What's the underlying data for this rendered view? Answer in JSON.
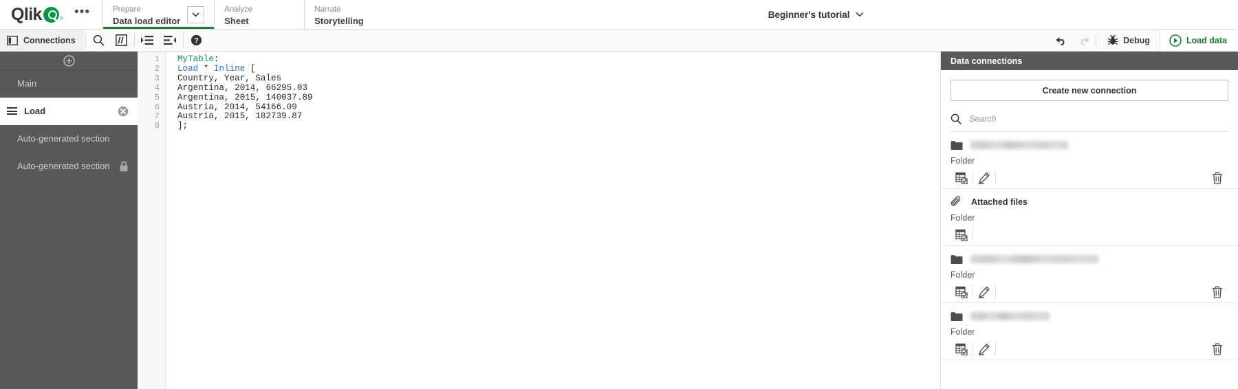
{
  "brand": {
    "name": "Qlik",
    "accent_green": "#009845",
    "active_tab_green": "#1a7d35",
    "sidebar_grey": "#595959"
  },
  "topbar": {
    "overflow_label": "•••",
    "tabs": [
      {
        "kicker": "Prepare",
        "title": "Data load editor",
        "active": true,
        "has_chevron": true
      },
      {
        "kicker": "Analyze",
        "title": "Sheet",
        "active": false,
        "has_chevron": false
      },
      {
        "kicker": "Narrate",
        "title": "Storytelling",
        "active": false,
        "has_chevron": false
      }
    ],
    "app_title": "Beginner's tutorial"
  },
  "toolbar": {
    "connections_label": "Connections",
    "icons": [
      {
        "name": "search-icon",
        "tooltip": "Search"
      },
      {
        "name": "comment-icon",
        "tooltip": "Comment"
      },
      {
        "name": "indent-icon",
        "tooltip": "Indent"
      },
      {
        "name": "outdent-icon",
        "tooltip": "Outdent"
      },
      {
        "name": "help-icon",
        "tooltip": "Help"
      }
    ],
    "undo_label": "Undo",
    "redo_label": "Redo",
    "redo_disabled": true,
    "debug_label": "Debug",
    "load_data_label": "Load data"
  },
  "sidebar": {
    "add_section_label": "+",
    "sections": [
      {
        "label": "Main",
        "selected": false,
        "locked": false,
        "closable": false
      },
      {
        "label": "Load",
        "selected": true,
        "locked": false,
        "closable": true
      },
      {
        "label": "Auto-generated section",
        "selected": false,
        "locked": false,
        "closable": false
      },
      {
        "label": "Auto-generated section",
        "selected": false,
        "locked": true,
        "closable": false
      }
    ]
  },
  "editor": {
    "line_numbers": [
      "1",
      "2",
      "3",
      "4",
      "5",
      "6",
      "7",
      "8"
    ],
    "lines": [
      {
        "tokens": [
          {
            "t": "MyTable",
            "c": "kw-table"
          },
          {
            "t": ":",
            "c": ""
          }
        ]
      },
      {
        "tokens": [
          {
            "t": "Load",
            "c": "kw-blue"
          },
          {
            "t": " * ",
            "c": ""
          },
          {
            "t": "Inline",
            "c": "kw-blue"
          },
          {
            "t": " [",
            "c": ""
          }
        ]
      },
      {
        "tokens": [
          {
            "t": "Country, Year, Sales",
            "c": ""
          }
        ]
      },
      {
        "tokens": [
          {
            "t": "Argentina, 2014, 66295.03",
            "c": ""
          }
        ]
      },
      {
        "tokens": [
          {
            "t": "Argentina, 2015, 140037.89",
            "c": ""
          }
        ]
      },
      {
        "tokens": [
          {
            "t": "Austria, 2014, 54166.09",
            "c": ""
          }
        ]
      },
      {
        "tokens": [
          {
            "t": "Austria, 2015, 182739.87",
            "c": ""
          }
        ]
      },
      {
        "tokens": [
          {
            "t": "];",
            "c": ""
          }
        ]
      }
    ]
  },
  "data_connections": {
    "panel_title": "Data connections",
    "create_button": "Create new connection",
    "search_placeholder": "Search",
    "items": [
      {
        "icon": "folder-icon",
        "name_redacted": true,
        "name_width": 142,
        "type": "Folder",
        "actions": [
          "select-data",
          "edit",
          "delete"
        ]
      },
      {
        "icon": "paperclip-icon",
        "name_redacted": false,
        "name": "Attached files",
        "type": "Folder",
        "actions": [
          "select-data"
        ]
      },
      {
        "icon": "folder-icon",
        "name_redacted": true,
        "name_width": 186,
        "type": "Folder",
        "actions": [
          "select-data",
          "edit",
          "delete"
        ]
      },
      {
        "icon": "folder-icon",
        "name_redacted": true,
        "name_width": 115,
        "type": "Folder",
        "actions": [
          "select-data",
          "edit",
          "delete"
        ]
      }
    ]
  }
}
